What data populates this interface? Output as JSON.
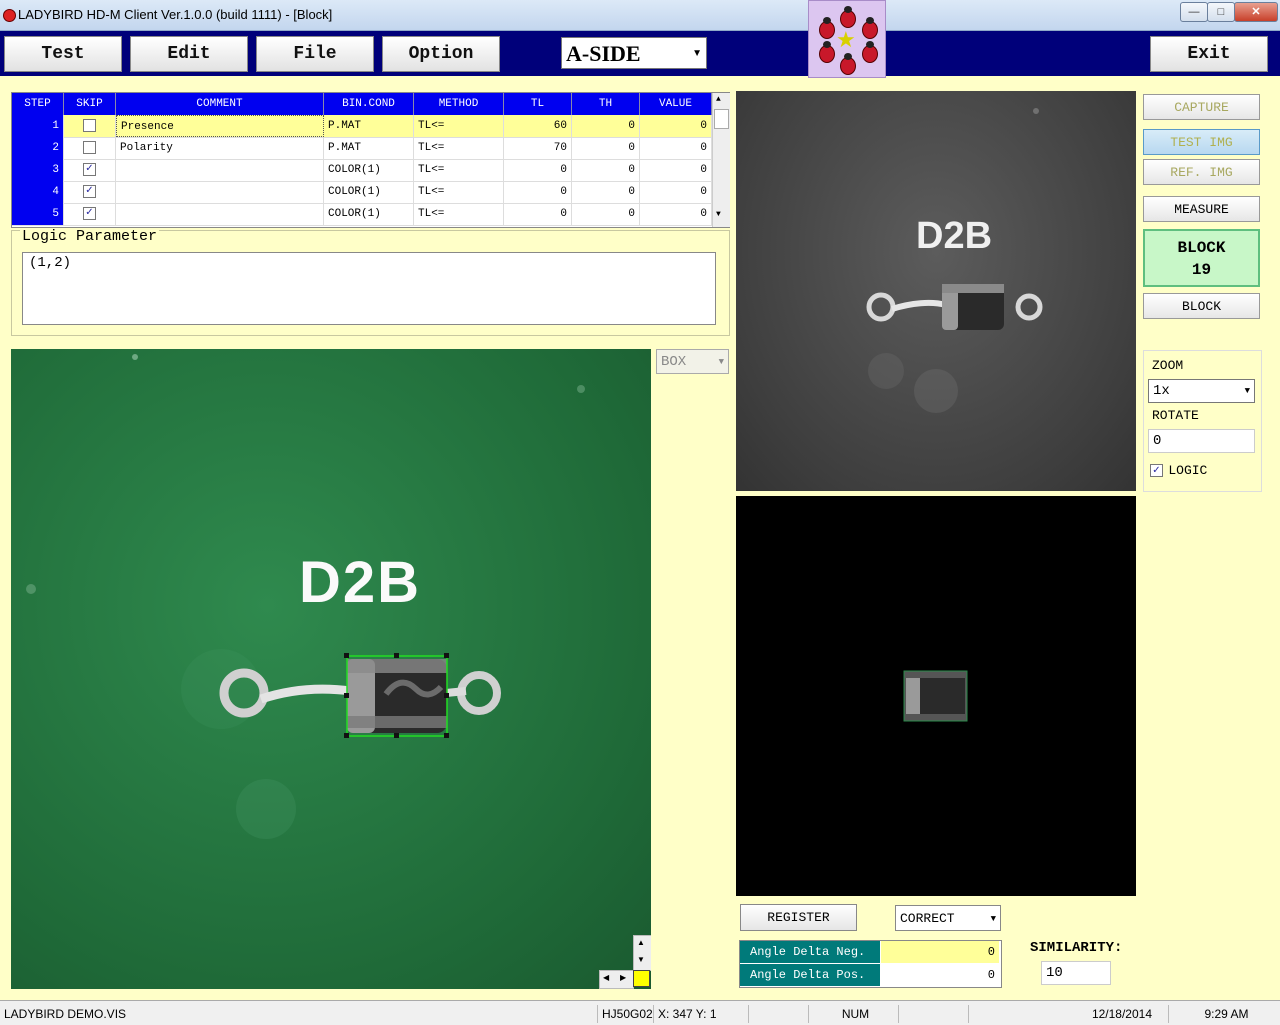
{
  "window": {
    "title": "LADYBIRD HD-M Client Ver.1.0.0  (build 1111) - [Block]",
    "min_label": "—",
    "max_label": "□",
    "close_label": "✕"
  },
  "toolbar": {
    "test": "Test",
    "edit": "Edit",
    "file": "File",
    "option": "Option",
    "side": "A-SIDE",
    "exit": "Exit"
  },
  "grid": {
    "headers": [
      "STEP",
      "SKIP",
      "COMMENT",
      "BIN.COND",
      "METHOD",
      "TL",
      "TH",
      "VALUE"
    ],
    "rows": [
      {
        "step": "1",
        "skip": false,
        "comment": "Presence",
        "bin": "P.MAT",
        "method": "TL<=",
        "tl": "60",
        "th": "0",
        "value": "0"
      },
      {
        "step": "2",
        "skip": false,
        "comment": "Polarity",
        "bin": "P.MAT",
        "method": "TL<=",
        "tl": "70",
        "th": "0",
        "value": "0"
      },
      {
        "step": "3",
        "skip": true,
        "comment": "",
        "bin": "COLOR(1)",
        "method": "TL<=",
        "tl": "0",
        "th": "0",
        "value": "0"
      },
      {
        "step": "4",
        "skip": true,
        "comment": "",
        "bin": "COLOR(1)",
        "method": "TL<=",
        "tl": "0",
        "th": "0",
        "value": "0"
      },
      {
        "step": "5",
        "skip": true,
        "comment": "",
        "bin": "COLOR(1)",
        "method": "TL<=",
        "tl": "0",
        "th": "0",
        "value": "0"
      }
    ]
  },
  "logic": {
    "label": "Logic Parameter",
    "value": "(1,2)"
  },
  "image": {
    "part_label": "D2B",
    "box_select": "BOX"
  },
  "right": {
    "capture": "CAPTURE",
    "test_img": "TEST IMG",
    "ref_img": "REF. IMG",
    "measure": "MEASURE",
    "block_title": "BLOCK",
    "block_num": "19",
    "block": "BLOCK",
    "zoom_label": "ZOOM",
    "zoom_value": "1x",
    "rotate_label": "ROTATE",
    "rotate_value": "0",
    "logic_label": "LOGIC"
  },
  "bottom": {
    "register": "REGISTER",
    "correct": "CORRECT",
    "angle_neg_label": "Angle Delta Neg.",
    "angle_neg_value": "0",
    "angle_pos_label": "Angle Delta Pos.",
    "angle_pos_value": "0",
    "similarity_label": "SIMILARITY:",
    "similarity_value": "10"
  },
  "status": {
    "file": "LADYBIRD DEMO.VIS",
    "model": "HJ50G02",
    "coords": "X: 347 Y:  1",
    "num": "NUM",
    "date": "12/18/2014",
    "time": "9:29 AM"
  },
  "colors": {
    "toolbar_bg": "#00007a",
    "panel_bg": "#ffffc8",
    "grid_header": "#0000f0",
    "selected_row": "#ffff99",
    "block_display": "#c8f7c8",
    "angle_label_bg": "#007a7a"
  }
}
